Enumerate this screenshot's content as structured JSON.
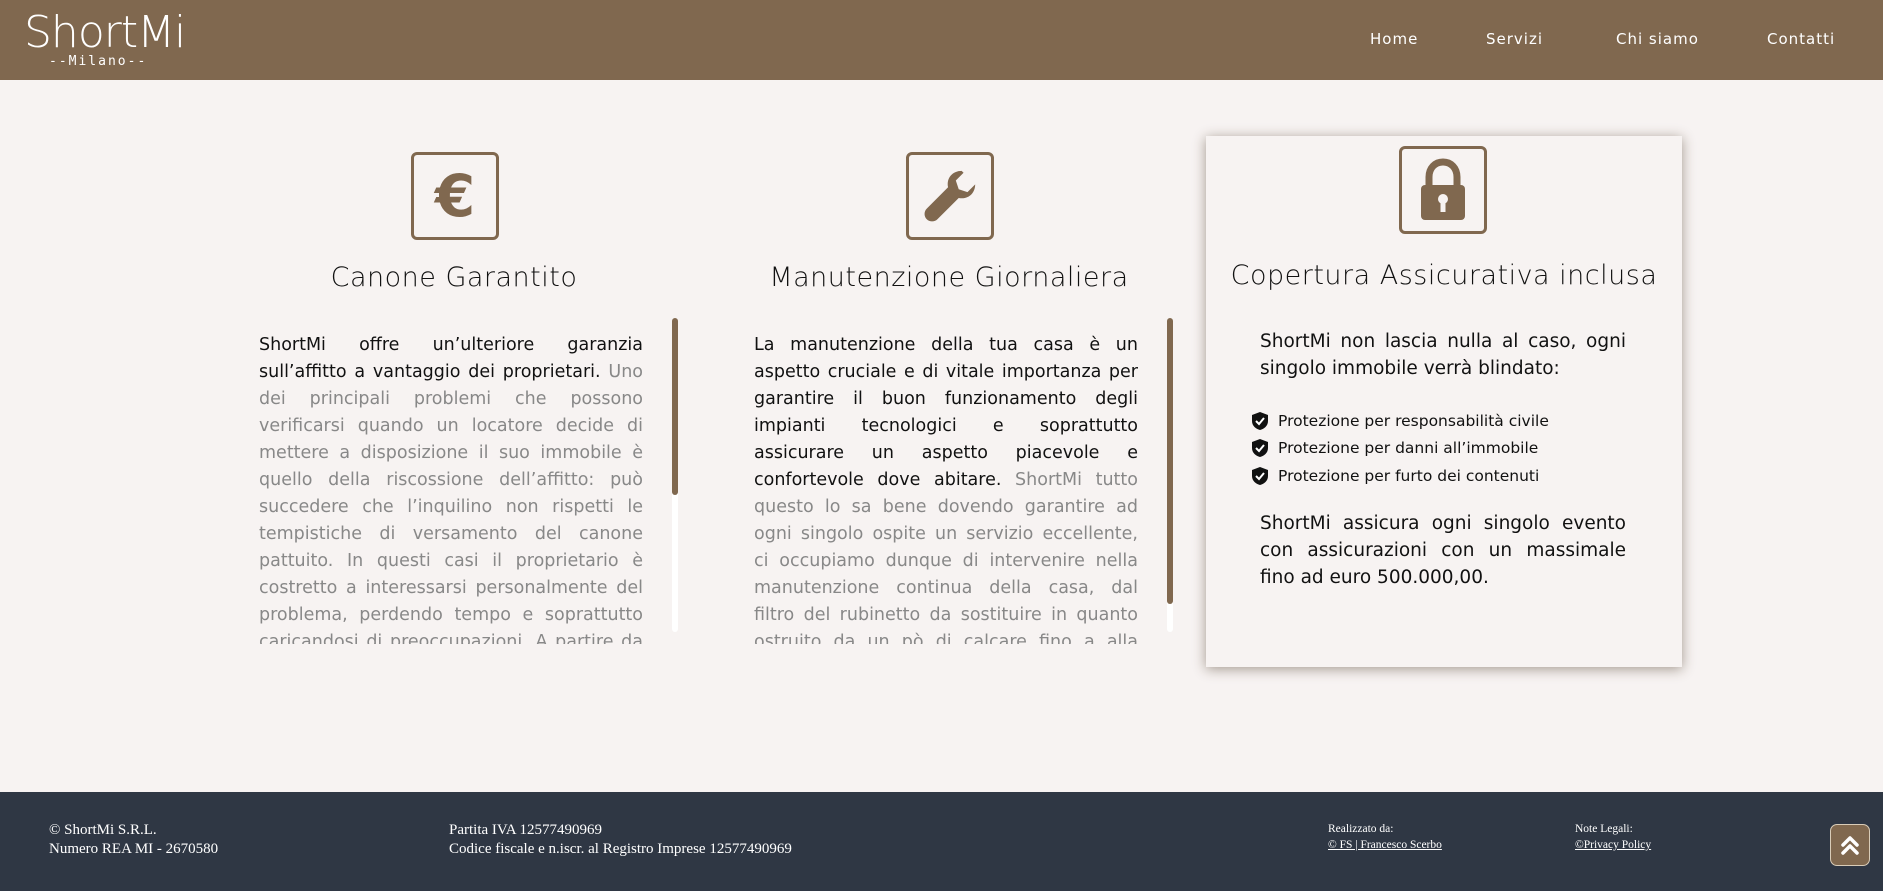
{
  "header": {
    "logo_main": "ShortMi",
    "logo_sub": "--Milano--",
    "nav": [
      "Home",
      "Servizi",
      "Chi siamo",
      "Contatti"
    ]
  },
  "cards": [
    {
      "icon": "euro-icon",
      "title": "Canone Garantito",
      "text_strong": "ShortMi offre un’ulteriore garanzia sull’affitto a vantaggio dei proprietari.",
      "text_light": " Uno dei principali problemi che possono verificarsi quando un locatore decide di mettere a disposizione il suo immobile è quello della riscossione dell’affitto: può succedere che l’inquilino non rispetti le tempistiche di versamento del canone pattuito. In questi casi il proprietario è costretto a interessarsi personalmente del problema, perdendo tempo e soprattutto caricandosi di preoccupazioni. A partire da un’amichevole sollecitazione verbale"
    },
    {
      "icon": "wrench-icon",
      "title": "Manutenzione Giornaliera",
      "text_strong": "La manutenzione della tua casa è un aspetto cruciale e di vitale importanza per garantire il buon funzionamento degli impianti tecnologici e soprattutto assicurare un aspetto piacevole e confortevole dove abitare.",
      "text_light": " ShortMi tutto questo lo sa bene dovendo garantire ad ogni singolo ospite un servizio eccellente, ci occupiamo dunque di intervenire nella manutenzione continua della casa, dal filtro del rubinetto da sostituire in quanto ostruito da un pò di calcare fino a alla sostituzione completa di un arredo ormai vetusto con uno più"
    },
    {
      "icon": "lock-icon",
      "title": "Copertura Assicurativa inclusa",
      "intro": "ShortMi non lascia nulla al caso, ogni singolo immobile verrà blindato:",
      "items": [
        "Protezione per responsabilità civile",
        "Protezione per danni all’immobile",
        "Protezione per furto dei contenuti"
      ],
      "outro": "ShortMi assicura ogni singolo evento con assicurazioni con un massimale fino ad euro 500.000,00."
    }
  ],
  "footer": {
    "company": "© ShortMi S.R.L.",
    "rea": "Numero REA MI - 2670580",
    "piva": "Partita IVA 12577490969",
    "codice_fiscale": "Codice fiscale e n.iscr. al Registro Imprese 12577490969",
    "made_by_label": "Realizzato da:",
    "made_by_link": "© FS | Francesco Scerbo",
    "legal_label": "Note Legali:",
    "privacy_link": "©Privacy Policy"
  },
  "colors": {
    "brand": "#80684f",
    "page_bg": "#f7f3f2",
    "footer_bg": "#2f3744"
  }
}
